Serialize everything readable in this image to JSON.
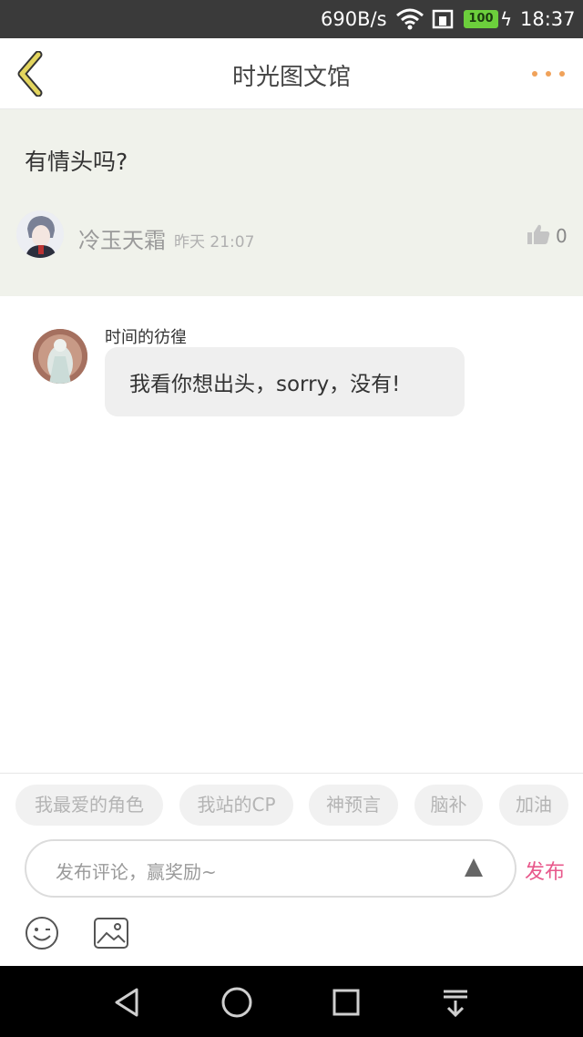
{
  "status_bar": {
    "net_speed": "690B/s",
    "battery": "100",
    "time": "18:37",
    "icons": [
      "wifi-icon",
      "sim-icon",
      "battery-icon",
      "charging-icon"
    ]
  },
  "header": {
    "title": "时光图文馆",
    "back_icon": "chevron-left-icon",
    "more_icon": "more-dots-icon",
    "accent_color": "#f0a25a",
    "back_color": "#d8c95a"
  },
  "post": {
    "text": "有情头吗?",
    "author": "冷玉天霜",
    "time": "昨天 21:07",
    "likes": "0",
    "background": "#f0f2eb"
  },
  "comments": [
    {
      "author": "时间的彷徨",
      "text": "我看你想出头，sorry，没有!"
    }
  ],
  "compose": {
    "tags": [
      "我最爱的角色",
      "我站的CP",
      "神预言",
      "脑补",
      "加油"
    ],
    "placeholder": "发布评论，赢奖励~",
    "publish_label": "发布",
    "publish_color": "#e8588b"
  },
  "nav_bar": {
    "icons": [
      "back-triangle-icon",
      "home-circle-icon",
      "recents-square-icon",
      "notification-pull-icon"
    ]
  }
}
